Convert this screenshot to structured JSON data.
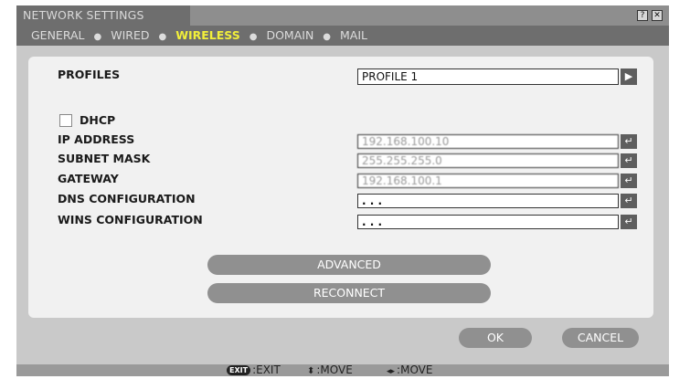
{
  "window": {
    "title": "NETWORK SETTINGS",
    "help_label": "?",
    "close_label": "✕"
  },
  "tabs": [
    {
      "label": "GENERAL"
    },
    {
      "label": "WIRED"
    },
    {
      "label": "WIRELESS",
      "active": true
    },
    {
      "label": "DOMAIN"
    },
    {
      "label": "MAIL"
    }
  ],
  "tab_separator": "●",
  "form": {
    "profiles_label": "PROFILES",
    "profiles_value": "PROFILE 1",
    "profiles_arrow": "▶",
    "dhcp_label": "DHCP",
    "dhcp_checked": false,
    "ip_label": "IP ADDRESS",
    "ip_value": "192.168.100.10",
    "subnet_label": "SUBNET MASK",
    "subnet_value": "255.255.255.0",
    "gateway_label": "GATEWAY",
    "gateway_value": "192.168.100.1",
    "dns_label": "DNS CONFIGURATION",
    "dns_value": ". . .",
    "wins_label": "WINS CONFIGURATION",
    "wins_value": ". . .",
    "enter_glyph": "↵"
  },
  "buttons": {
    "advanced": "ADVANCED",
    "reconnect": "RECONNECT",
    "ok": "OK",
    "cancel": "CANCEL"
  },
  "footer": {
    "exit_badge": "EXIT",
    "exit_text": ":EXIT",
    "move_v_glyph": "⬍",
    "move_v_text": ":MOVE",
    "move_h_glyph": "◂▸",
    "move_h_text": ":MOVE"
  },
  "colors": {
    "active_tab": "#f2ef3a",
    "window_bg": "#c9c9c9",
    "panel_bg": "#f1f1f1",
    "button_bg": "#909090"
  }
}
